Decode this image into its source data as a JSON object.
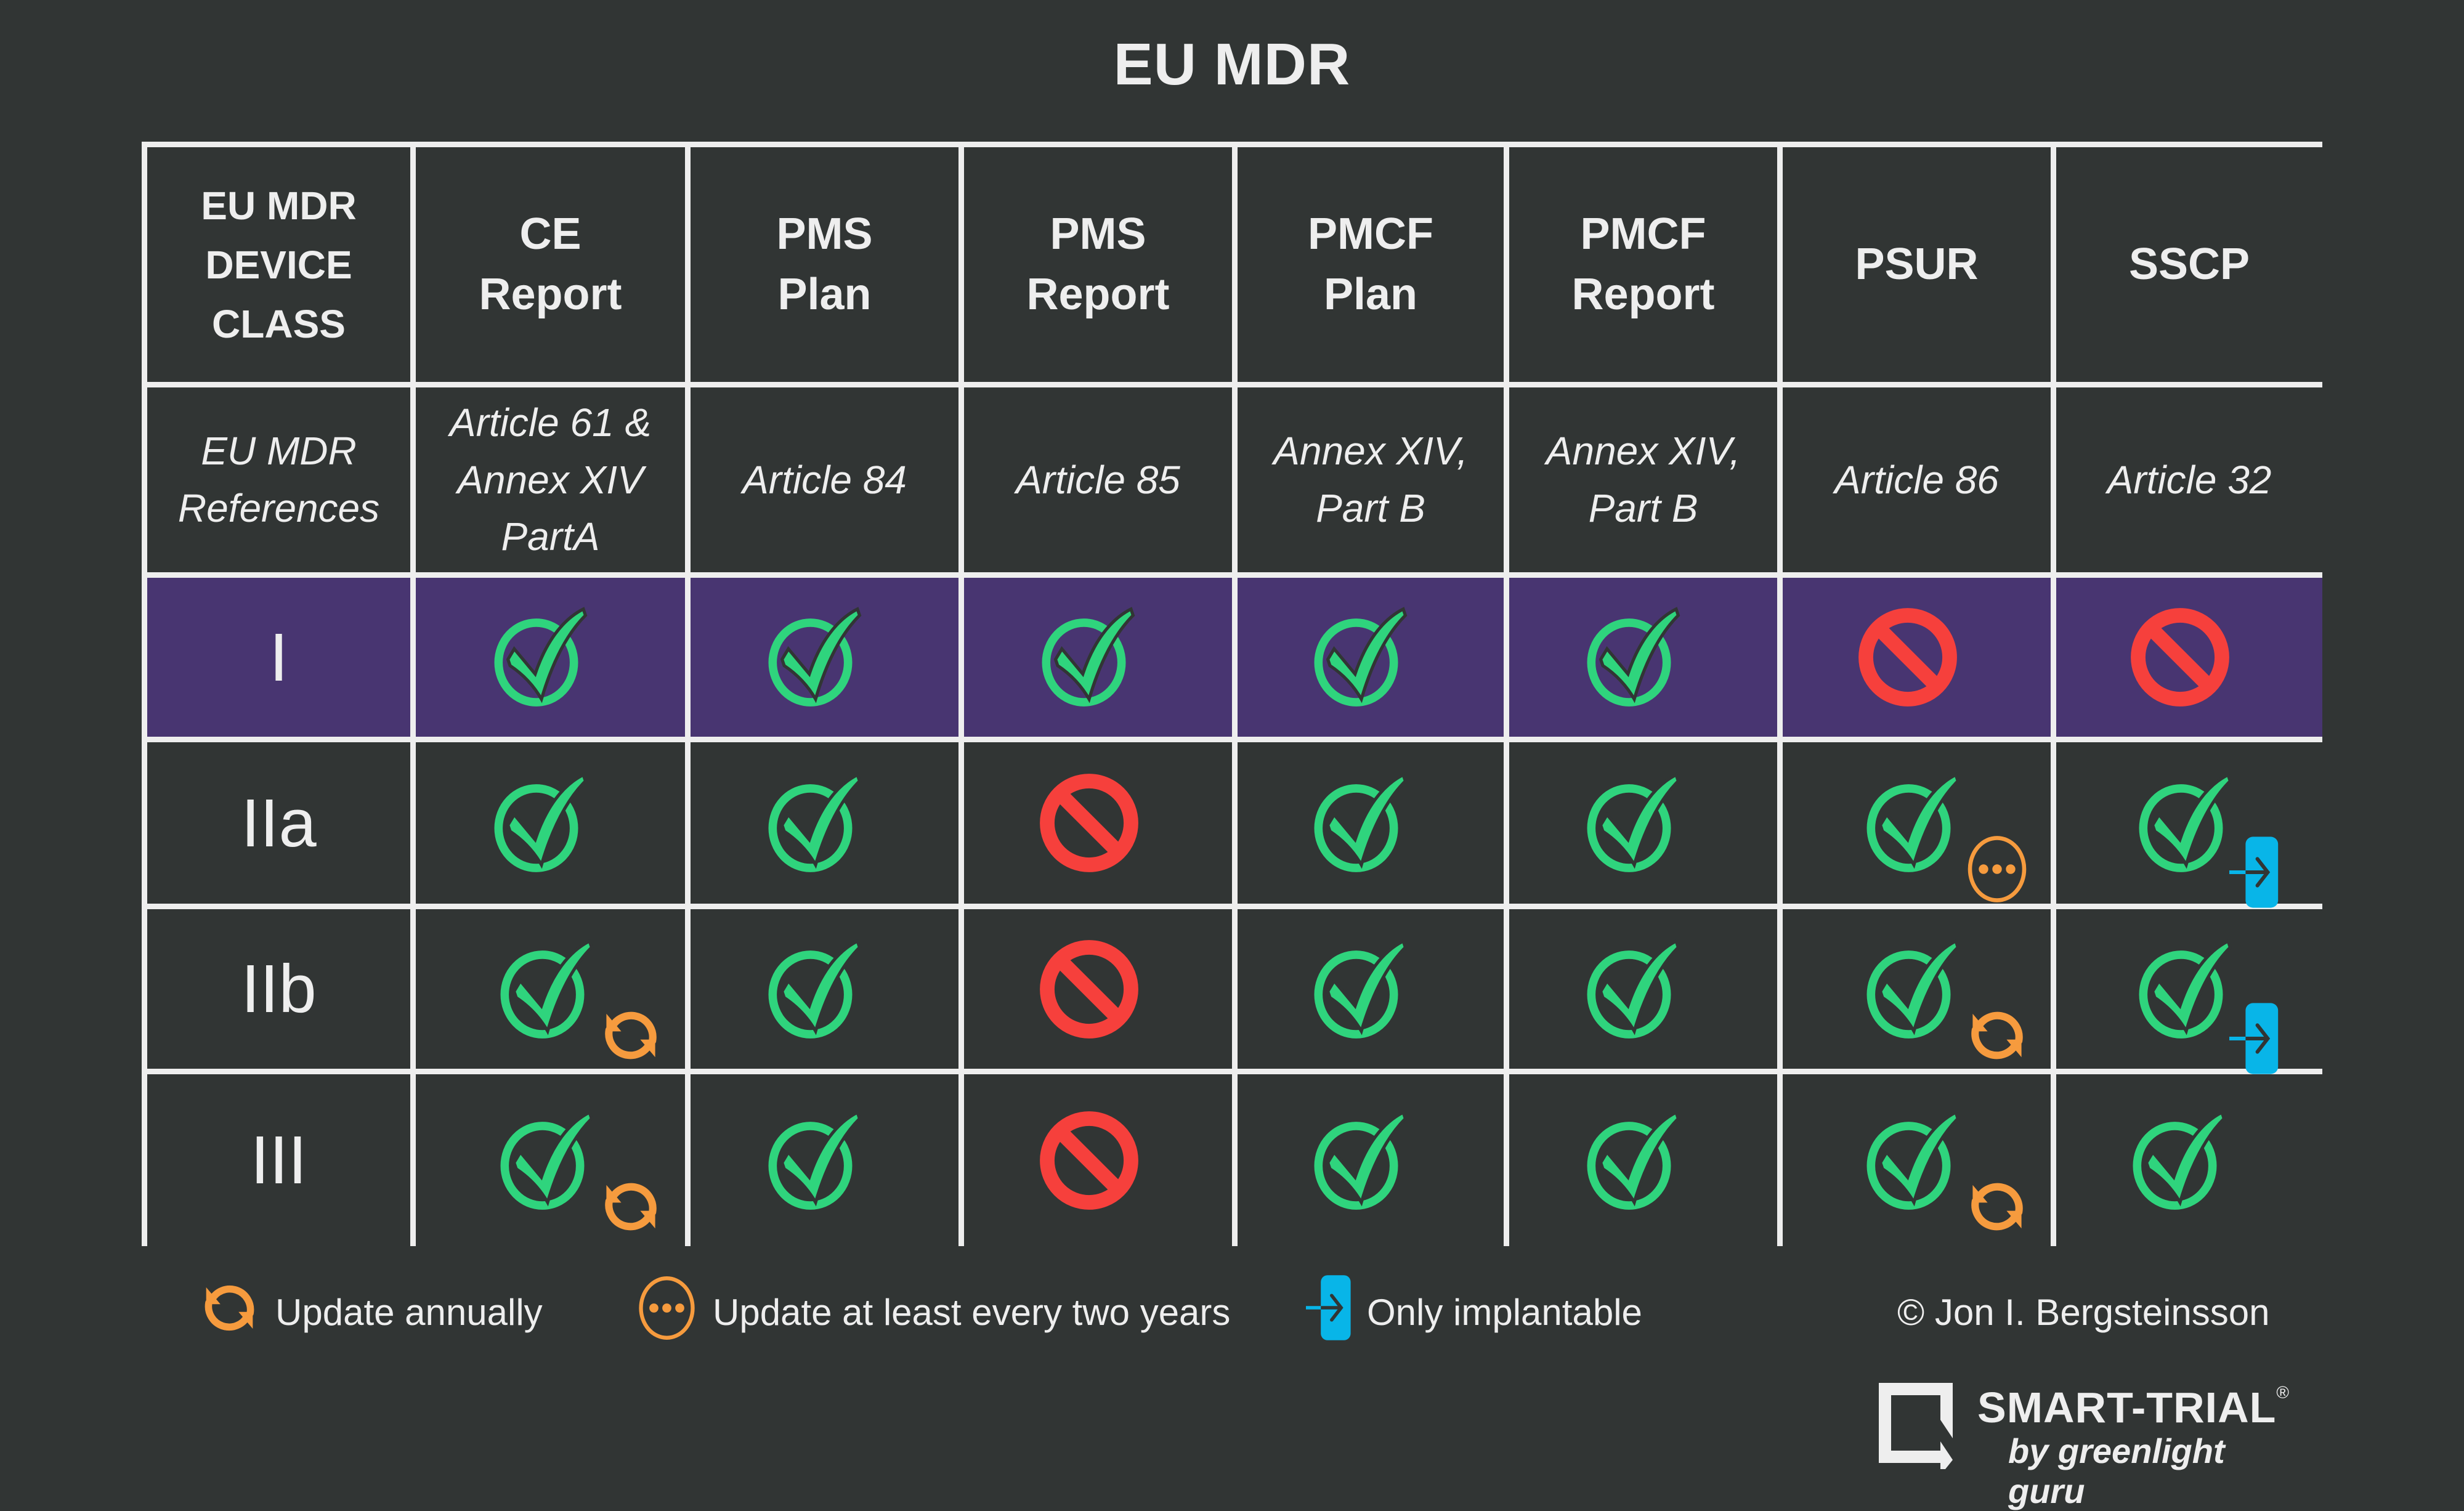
{
  "title": "EU MDR",
  "colors": {
    "background": "#313534",
    "grid": "#eeeeee",
    "highlight_row": "#483571",
    "yes": "#2fd47d",
    "no": "#f6403c",
    "annual": "#f69b3e",
    "biennial": "#f69b3e",
    "implantable": "#08b5e8"
  },
  "table": {
    "corner_header": [
      "EU MDR",
      "DEVICE",
      "CLASS"
    ],
    "columns": [
      {
        "header": [
          "CE",
          "Report"
        ],
        "reference": [
          "Article 61 &",
          "Annex XIV PartA"
        ]
      },
      {
        "header": [
          "PMS",
          "Plan"
        ],
        "reference": [
          "Article 84"
        ]
      },
      {
        "header": [
          "PMS",
          "Report"
        ],
        "reference": [
          "Article 85"
        ]
      },
      {
        "header": [
          "PMCF",
          "Plan"
        ],
        "reference": [
          "Annex XIV,",
          "Part B"
        ]
      },
      {
        "header": [
          "PMCF",
          "Report"
        ],
        "reference": [
          "Annex XIV,",
          "Part B"
        ]
      },
      {
        "header": [
          "PSUR"
        ],
        "reference": [
          "Article 86"
        ]
      },
      {
        "header": [
          "SSCP"
        ],
        "reference": [
          "Article 32"
        ]
      }
    ],
    "references_label": [
      "EU MDR",
      "References"
    ],
    "rows": [
      {
        "class": "I",
        "highlighted": true,
        "cells": [
          {
            "status": "yes"
          },
          {
            "status": "yes"
          },
          {
            "status": "yes"
          },
          {
            "status": "yes"
          },
          {
            "status": "yes"
          },
          {
            "status": "no"
          },
          {
            "status": "no"
          }
        ]
      },
      {
        "class": "IIa",
        "highlighted": false,
        "cells": [
          {
            "status": "yes"
          },
          {
            "status": "yes"
          },
          {
            "status": "no"
          },
          {
            "status": "yes"
          },
          {
            "status": "yes"
          },
          {
            "status": "yes",
            "modifier": "biennial"
          },
          {
            "status": "yes",
            "modifier": "implantable"
          }
        ]
      },
      {
        "class": "IIb",
        "highlighted": false,
        "cells": [
          {
            "status": "yes",
            "modifier": "annual"
          },
          {
            "status": "yes"
          },
          {
            "status": "no"
          },
          {
            "status": "yes"
          },
          {
            "status": "yes"
          },
          {
            "status": "yes",
            "modifier": "annual"
          },
          {
            "status": "yes",
            "modifier": "implantable"
          }
        ]
      },
      {
        "class": "III",
        "highlighted": false,
        "cells": [
          {
            "status": "yes",
            "modifier": "annual"
          },
          {
            "status": "yes"
          },
          {
            "status": "no"
          },
          {
            "status": "yes"
          },
          {
            "status": "yes"
          },
          {
            "status": "yes",
            "modifier": "annual"
          },
          {
            "status": "yes"
          }
        ]
      }
    ]
  },
  "icons": {
    "yes": "check-circle-icon",
    "no": "prohibited-icon",
    "annual": "refresh-icon",
    "biennial": "ellipsis-circle-icon",
    "implantable": "implant-arrow-icon"
  },
  "legend": [
    {
      "icon": "annual",
      "label": "Update annually"
    },
    {
      "icon": "biennial",
      "label": "Update at least every two years"
    },
    {
      "icon": "implantable",
      "label": "Only implantable"
    }
  ],
  "copyright": "© Jon I. Bergsteinsson",
  "logo": {
    "brand": "SMART-TRIAL",
    "registered": "®",
    "tagline": "by greenlight guru"
  }
}
